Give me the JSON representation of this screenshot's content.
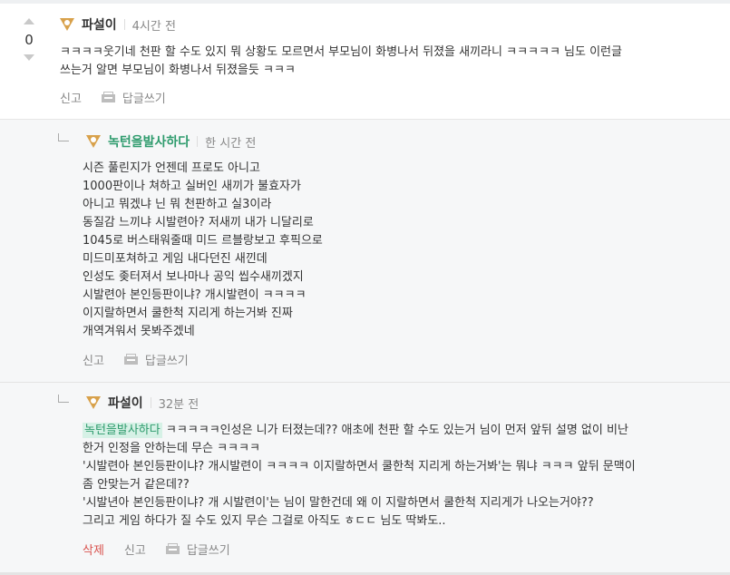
{
  "comments": [
    {
      "author": "파설이",
      "time": "4시간 전",
      "votes": "0",
      "body": "ㅋㅋㅋㅋ웃기네 천판 할 수도 있지 뭐 상황도 모르면서 부모님이 화병나서 뒤졌을 새끼라니 ㅋㅋㅋㅋㅋ 님도 이런글\n쓰는거 알면 부모님이 화병나서 뒤졌을듯 ㅋㅋㅋ",
      "report": "신고",
      "reply": "답글쓰기"
    },
    {
      "author": "녹턴을발사하다",
      "time": "한 시간 전",
      "body": "시즌 풀린지가 언젠데 프로도 아니고\n1000판이나 쳐하고 실버인 새끼가 불효자가\n아니고 뭐겠냐 닌 뭐 천판하고 실3이라\n동질감 느끼냐 시발련아? 저새끼 내가 니달리로\n1045로 버스태워줄때 미드 르블랑보고 후픽으로\n미드미포쳐하고 게임 내다던진 새낀데\n인성도 좆터져서 보나마나 공익 씹수새끼겠지\n시발련아 본인등판이냐? 개시발련이 ㅋㅋㅋㅋ\n이지랄하면서 쿨한척 지리게 하는거봐 진짜\n개역겨워서 못봐주겠네",
      "report": "신고",
      "reply": "답글쓰기"
    },
    {
      "author": "파설이",
      "time": "32분 전",
      "mention": "녹턴을발사하다",
      "body_after_mention": " ㅋㅋㅋㅋㅋ인성은 니가 터졌는데?? 애초에 천판 할 수도 있는거 님이 먼저 앞뒤 설명 없이 비난\n한거 인정을 안하는데 무슨 ㅋㅋㅋㅋ\n'시발련아 본인등판이냐? 개시발련이 ㅋㅋㅋㅋ 이지랄하면서 쿨한척 지리게 하는거봐'는 뭐냐 ㅋㅋㅋ 앞뒤 문맥이\n좀 안맞는거 같은데??\n'시발년아 본인등판이냐? 개 시발련이'는 님이 말한건데 왜 이 지랄하면서 쿨한척 지리게가 나오는거야??\n그리고 게임 하다가 질 수도 있지 무슨 그걸로 아직도 ㅎㄷㄷ 님도 딱봐도..",
      "delete": "삭제",
      "report": "신고",
      "reply": "답글쓰기"
    }
  ],
  "colors": {
    "badge": "#d8a14b",
    "reply_author": "#2e9b6d",
    "delete": "#d9534f",
    "reply_bg": "#f6f7f8"
  },
  "icons": {
    "level": "triangle-level-badge-icon",
    "reply": "reply-box-icon",
    "vote_up": "vote-up-arrow-icon",
    "vote_down": "vote-down-arrow-icon"
  }
}
